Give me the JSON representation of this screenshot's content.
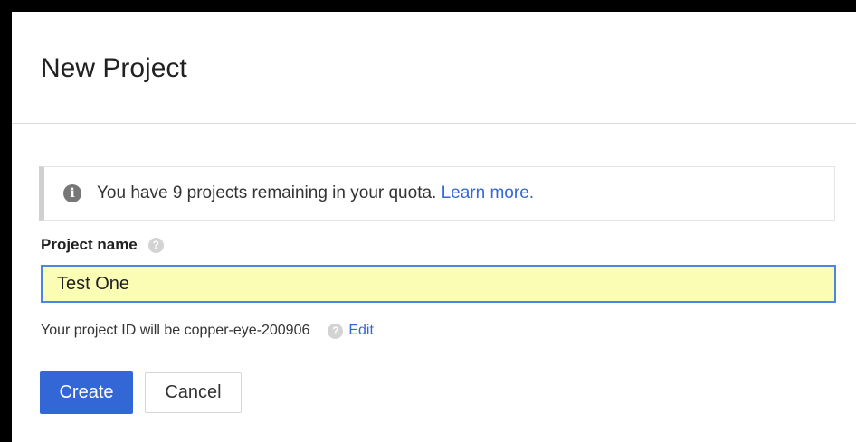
{
  "dialog": {
    "title": "New Project"
  },
  "info": {
    "icon": "info-icon",
    "text": "You have 9 projects remaining in your quota. ",
    "link": "Learn more."
  },
  "project_name": {
    "label": "Project name",
    "help_icon": "help-icon",
    "value": "Test One",
    "placeholder": ""
  },
  "project_id": {
    "text": "Your project ID will be copper-eye-200906",
    "help_icon": "help-icon",
    "edit_label": "Edit"
  },
  "actions": {
    "create_label": "Create",
    "cancel_label": "Cancel"
  },
  "colors": {
    "primary": "#3367d6",
    "input_background": "#fbfdb4",
    "input_border": "#4a86e8",
    "frame": "#000000"
  }
}
